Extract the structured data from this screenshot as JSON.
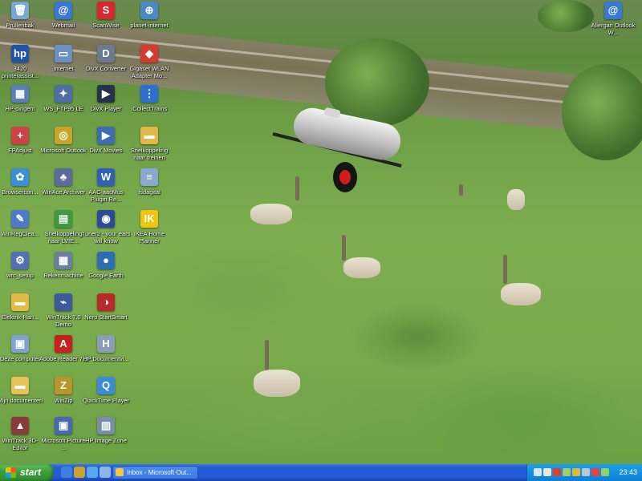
{
  "desktop": {
    "icons": [
      {
        "label": "Prullenbak",
        "glyph": "🗑",
        "color": "#7aa6d6",
        "icon": "recycle-bin-icon"
      },
      {
        "label": "Webmail",
        "glyph": "@",
        "color": "#3a78d4",
        "icon": "webmail-icon"
      },
      {
        "label": "ScanWise",
        "glyph": "S",
        "color": "#d8282d",
        "icon": "scanwise-icon"
      },
      {
        "label": "planet-internet",
        "glyph": "⊕",
        "color": "#4a89c8",
        "icon": "planet-internet-icon"
      },
      {
        "label": "3420 printerassist...",
        "glyph": "hp",
        "color": "#2054a6",
        "icon": "hp-printer-icon"
      },
      {
        "label": "Internet",
        "glyph": "▭",
        "color": "#6b8fc0",
        "icon": "internet-shortcut-icon"
      },
      {
        "label": "DivX Converter",
        "glyph": "D",
        "color": "#6b7b8f",
        "icon": "divx-converter-icon"
      },
      {
        "label": "Gigaset WLAN Adapter Mo...",
        "glyph": "◆",
        "color": "#d63b2f",
        "icon": "gigaset-icon"
      },
      {
        "label": "HP-dirigent",
        "glyph": "▦",
        "color": "#5a7fb0",
        "icon": "hp-director-icon"
      },
      {
        "label": "WS_FTP95 LE",
        "glyph": "✦",
        "color": "#4d6fa6",
        "icon": "ftp-icon"
      },
      {
        "label": "DivX Player",
        "glyph": "▶",
        "color": "#25324a",
        "icon": "divx-player-icon"
      },
      {
        "label": "iCollectTrains",
        "glyph": "⋮",
        "color": "#2f6fd0",
        "icon": "icollect-trains-icon"
      },
      {
        "label": "FPAdjust",
        "glyph": "+",
        "color": "#c94545",
        "icon": "fpadjust-icon"
      },
      {
        "label": "Microsoft Outlook",
        "glyph": "◎",
        "color": "#c8a52a",
        "icon": "outlook-icon"
      },
      {
        "label": "DivX Movies",
        "glyph": "▶",
        "color": "#3d6db0",
        "icon": "divx-movies-icon"
      },
      {
        "label": "Snelkoppeling naar treinen",
        "glyph": "▬",
        "color": "#e2b846",
        "icon": "folder-shortcut-icon"
      },
      {
        "label": "Browsercon...",
        "glyph": "✿",
        "color": "#3c8fd6",
        "icon": "browser-config-icon"
      },
      {
        "label": "WinAce Archiver",
        "glyph": "♣",
        "color": "#5a6b9c",
        "icon": "winace-icon"
      },
      {
        "label": "AAC-aacMus Plugin Re...",
        "glyph": "W",
        "color": "#3160b8",
        "icon": "word-document-icon"
      },
      {
        "label": "fsdagital",
        "glyph": "≡",
        "color": "#8aa8d0",
        "icon": "document-icon"
      },
      {
        "label": "WinRegClea...",
        "glyph": "✎",
        "color": "#4d7ac8",
        "icon": "winregclean-icon"
      },
      {
        "label": "Snelkoppeling naar LVIE...",
        "glyph": "▤",
        "color": "#3e9a3e",
        "icon": "shortcut-icon"
      },
      {
        "label": "Tuner2 - your ears will know",
        "glyph": "◉",
        "color": "#2b4b9a",
        "icon": "tuner-icon"
      },
      {
        "label": "IKEA Home Planner",
        "glyph": "IK",
        "color": "#f1c40f",
        "icon": "ikea-icon"
      },
      {
        "label": "wrc_setup",
        "glyph": "⚙",
        "color": "#5470b5",
        "icon": "setup-icon"
      },
      {
        "label": "Rekenmachine",
        "glyph": "▦",
        "color": "#6b7fa0",
        "icon": "calculator-icon"
      },
      {
        "label": "Google Earth",
        "glyph": "●",
        "color": "#2d6db5",
        "icon": "google-earth-icon"
      },
      {
        "label": "Elektrik-Han...",
        "glyph": "▬",
        "color": "#e2b846",
        "icon": "folder-icon"
      },
      {
        "label": "WinTrack 7.0 Demo",
        "glyph": "⌁",
        "color": "#3b5a9a",
        "icon": "wintrack-icon"
      },
      {
        "label": "Nero StartSmart",
        "glyph": "◑",
        "color": "#b82a2a",
        "icon": "nero-icon"
      },
      {
        "label": "Deze computer",
        "glyph": "▣",
        "color": "#7fa2cf",
        "icon": "my-computer-icon"
      },
      {
        "label": "Adobe Reader 7.0",
        "glyph": "A",
        "color": "#c4221f",
        "icon": "adobe-reader-icon"
      },
      {
        "label": "HP Documentvi...",
        "glyph": "H",
        "color": "#8a9db5",
        "icon": "hp-document-viewer-icon"
      },
      {
        "label": "Mijn documenten",
        "glyph": "▬",
        "color": "#e7c25a",
        "icon": "my-documents-icon"
      },
      {
        "label": "WinZip",
        "glyph": "Z",
        "color": "#b8962a",
        "icon": "winzip-icon"
      },
      {
        "label": "QuickTime Player",
        "glyph": "Q",
        "color": "#3a8bd8",
        "icon": "quicktime-icon"
      },
      {
        "label": "WinTrack 3D-Editor",
        "glyph": "▲",
        "color": "#8a3b3b",
        "icon": "wintrack-3d-icon"
      },
      {
        "label": "Microsoft Picture ...",
        "glyph": "▣",
        "color": "#4868b0",
        "icon": "picture-manager-icon"
      },
      {
        "label": "HP Image Zone",
        "glyph": "▥",
        "color": "#7a8ca8",
        "icon": "hp-image-zone-icon"
      },
      {
        "label": "Allergan Outlook W...",
        "glyph": "@",
        "color": "#3a78d4",
        "icon": "allergan-outlook-icon"
      }
    ]
  },
  "taskbar": {
    "start_label": "start",
    "quick_launch": [
      {
        "icon": "outlook-express-icon",
        "color": "#3f7fe0"
      },
      {
        "icon": "winzip-quicklaunch-icon",
        "color": "#c8a52a"
      },
      {
        "icon": "internet-explorer-icon",
        "color": "#58a8f0"
      },
      {
        "icon": "show-desktop-icon",
        "color": "#8fb6e8"
      }
    ],
    "task": {
      "label": "Inbox - Microsoft Out..."
    },
    "tray_icons": [
      {
        "icon": "network-icon",
        "color": "#cfe7ff"
      },
      {
        "icon": "volume-icon",
        "color": "#e8e8e8"
      },
      {
        "icon": "antivirus-icon",
        "color": "#d9412f"
      },
      {
        "icon": "usb-icon",
        "color": "#9fcf6f"
      },
      {
        "icon": "security-shield-icon",
        "color": "#e0b93a"
      },
      {
        "icon": "printer-icon",
        "color": "#b8c6d8"
      },
      {
        "icon": "update-icon",
        "color": "#e24444"
      },
      {
        "icon": "messenger-icon",
        "color": "#8fd16f"
      }
    ],
    "clock": "23:43"
  }
}
